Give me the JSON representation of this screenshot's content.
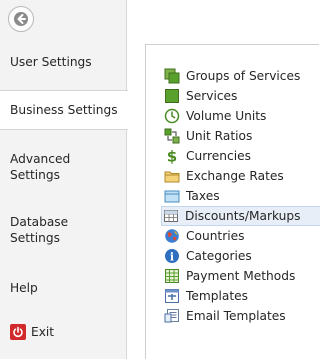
{
  "nav": {
    "back_icon": "back-arrow-icon",
    "items": [
      {
        "label": "User Settings"
      },
      {
        "label": "Business Settings"
      },
      {
        "label": "Advanced Settings"
      },
      {
        "label": "Database Settings"
      },
      {
        "label": "Help"
      },
      {
        "label": "Exit"
      }
    ],
    "selected_index": 1
  },
  "business_settings": {
    "items": [
      {
        "label": "Groups of Services",
        "icon": "groups-of-services-icon"
      },
      {
        "label": "Services",
        "icon": "services-icon"
      },
      {
        "label": "Volume Units",
        "icon": "volume-units-icon"
      },
      {
        "label": "Unit Ratios",
        "icon": "unit-ratios-icon"
      },
      {
        "label": "Currencies",
        "icon": "currencies-icon"
      },
      {
        "label": "Exchange Rates",
        "icon": "exchange-rates-icon"
      },
      {
        "label": "Taxes",
        "icon": "taxes-icon"
      },
      {
        "label": "Discounts/Markups",
        "icon": "discounts-markups-icon"
      },
      {
        "label": "Countries",
        "icon": "countries-icon"
      },
      {
        "label": "Categories",
        "icon": "categories-icon"
      },
      {
        "label": "Payment Methods",
        "icon": "payment-methods-icon"
      },
      {
        "label": "Templates",
        "icon": "templates-icon"
      },
      {
        "label": "Email Templates",
        "icon": "email-templates-icon"
      }
    ],
    "hovered_index": 7
  },
  "colors": {
    "nav_background": "#f3f3f3",
    "selected_background": "#ffffff",
    "hover_background": "#e7eef7",
    "exit_icon_red": "#d22a2a",
    "green_icon": "#5aa02c"
  }
}
